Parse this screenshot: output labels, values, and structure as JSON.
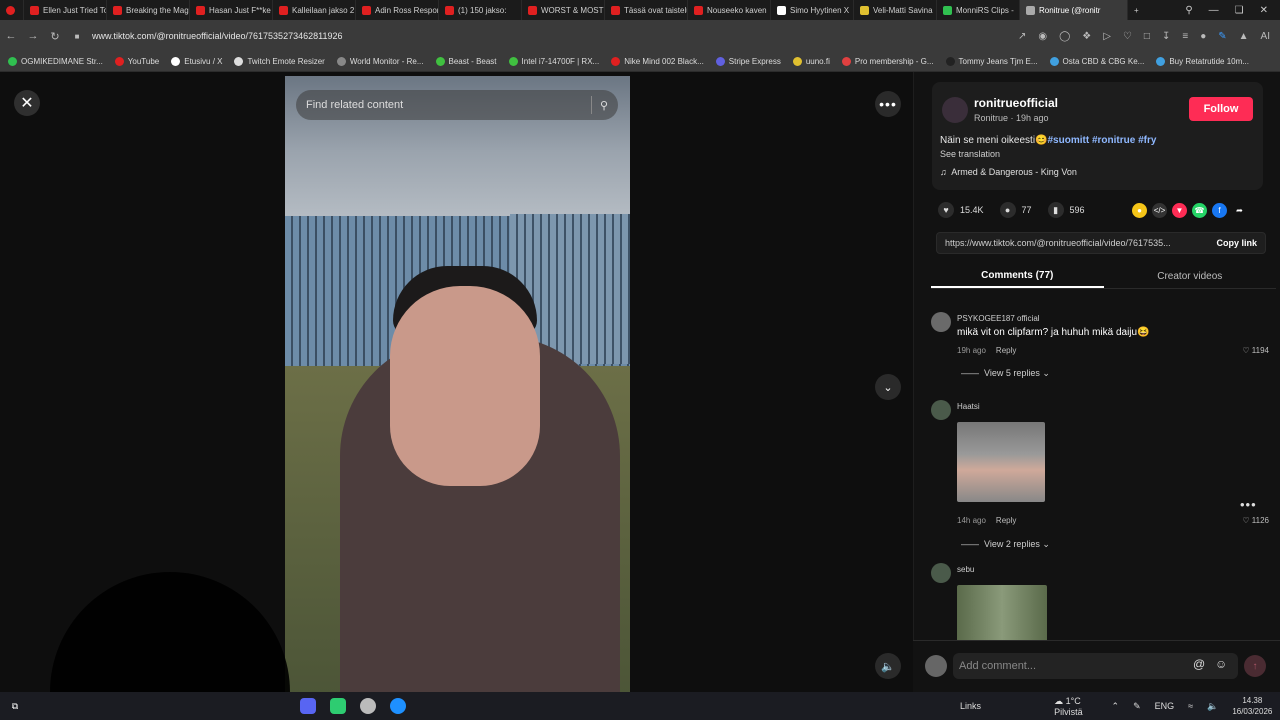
{
  "browser": {
    "tabs": [
      {
        "label": "Ellen Just Tried To",
        "color": "#e02020"
      },
      {
        "label": "Breaking the Mag",
        "color": "#e02020"
      },
      {
        "label": "Hasan Just F**ke",
        "color": "#e02020"
      },
      {
        "label": "Kalleilaan jakso 2",
        "color": "#e02020"
      },
      {
        "label": "Adin Ross Respon",
        "color": "#e02020"
      },
      {
        "label": "(1) 150 jakso:",
        "color": "#e02020"
      },
      {
        "label": "WORST & MOST",
        "color": "#e02020"
      },
      {
        "label": "Tässä ovat taistelu",
        "color": "#e02020"
      },
      {
        "label": "Nouseeko kaven",
        "color": "#e02020"
      },
      {
        "label": "Simo Hyytinen X",
        "color": "#ffffff"
      },
      {
        "label": "Veli-Matti Savina",
        "color": "#e0c030"
      },
      {
        "label": "MonniRS Clips -",
        "color": "#30c050"
      },
      {
        "label": "Ronitrue (@ronitr",
        "color": "#aaaaaa"
      }
    ],
    "new_tab": "+",
    "url": "www.tiktok.com/@ronitrueofficial/video/7617535273462811926",
    "bookmarks": [
      {
        "label": "OGMIKEDIMANE Str...",
        "color": "#30c050"
      },
      {
        "label": "YouTube",
        "color": "#e02020"
      },
      {
        "label": "Etusivu / X",
        "color": "#ffffff"
      },
      {
        "label": "Twitch Emote Resizer",
        "color": "#dddddd"
      },
      {
        "label": "World Monitor - Re...",
        "color": "#888888"
      },
      {
        "label": "Beast - Beast",
        "color": "#40c040"
      },
      {
        "label": "Intel i7-14700F | RX...",
        "color": "#40c040"
      },
      {
        "label": "Nike Mind 002 Black...",
        "color": "#e02020"
      },
      {
        "label": "Stripe Express",
        "color": "#6060e0"
      },
      {
        "label": "uuno.fi",
        "color": "#e0c030"
      },
      {
        "label": "Pro membership - G...",
        "color": "#e04040"
      },
      {
        "label": "Tommy Jeans Tjm E...",
        "color": "#222222"
      },
      {
        "label": "Osta CBD & CBG Ke...",
        "color": "#40a0e0"
      },
      {
        "label": "Buy Retatrutide 10m...",
        "color": "#40a0e0"
      }
    ]
  },
  "player": {
    "search_placeholder": "Find related content"
  },
  "post": {
    "username": "ronitrueofficial",
    "meta": "Ronitrue · 19h ago",
    "follow_label": "Follow",
    "description_text": "Näin se meni oikeesti😊",
    "hashtags": "#suomitt #ronitrue #fry",
    "see_translation": "See translation",
    "music": "Armed & Dangerous - King Von",
    "likes": "15.4K",
    "comments_count": "77",
    "saves": "596",
    "link": "https://www.tiktok.com/@ronitrueofficial/video/7617535...",
    "copy_link": "Copy link",
    "tab_comments": "Comments (77)",
    "tab_creator": "Creator videos"
  },
  "comments": [
    {
      "name": "PSYKOGEE187 official",
      "text": "mikä vit on clipfarm? ja huhuh mikä daiju😆",
      "time": "19h ago",
      "reply": "Reply",
      "likes": "1194",
      "replies": "View 5 replies"
    },
    {
      "name": "Haatsi",
      "text": "",
      "time": "14h ago",
      "reply": "Reply",
      "likes": "1126",
      "replies": "View 2 replies"
    },
    {
      "name": "sebu",
      "text": "",
      "time": "",
      "reply": "",
      "likes": "",
      "replies": ""
    }
  ],
  "compose": {
    "placeholder": "Add comment..."
  },
  "taskbar": {
    "links": "Links",
    "weather": "1°C  Pilvistä",
    "lang": "ENG",
    "time": "14.38",
    "date": "16/03/2026"
  },
  "colors": {
    "accent": "#fe2c55",
    "hashtag": "#8fb8ff"
  }
}
